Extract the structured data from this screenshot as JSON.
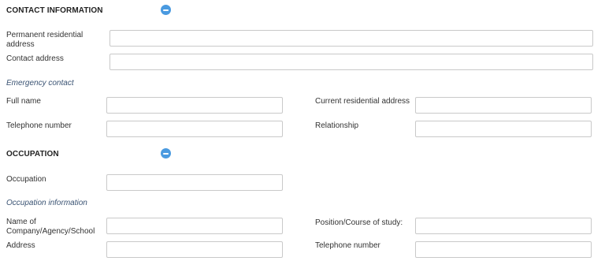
{
  "contact": {
    "title": "CONTACT INFORMATION",
    "permanent_label": "Permanent residential address",
    "permanent_value": "",
    "contact_address_label": "Contact address",
    "contact_address_value": "",
    "emergency_heading": "Emergency contact",
    "full_name_label": "Full name",
    "full_name_value": "",
    "current_address_label": "Current residential address",
    "current_address_value": "",
    "telephone_label": "Telephone number",
    "telephone_value": "",
    "relationship_label": "Relationship",
    "relationship_value": ""
  },
  "occupation": {
    "title": "OCCUPATION",
    "occupation_label": "Occupation",
    "occupation_value": "",
    "info_heading": "Occupation information",
    "company_label": "Name of Company/Agency/School",
    "company_value": "",
    "position_label": "Position/Course of study:",
    "position_value": "",
    "address_label": "Address",
    "address_value": "",
    "telephone_label": "Telephone number",
    "telephone_value": ""
  },
  "icons": {
    "collapse": "minus-circle-icon"
  },
  "colors": {
    "accent": "#4a9ae0",
    "subheading": "#3a5373"
  }
}
